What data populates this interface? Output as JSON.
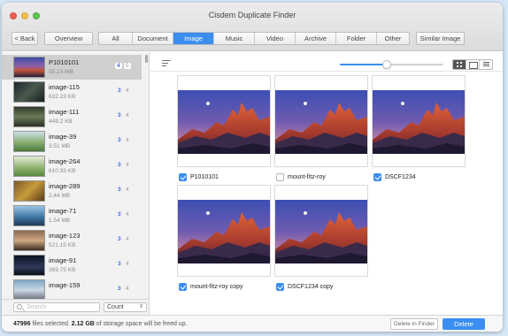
{
  "window": {
    "title": "Cisdem Duplicate Finder"
  },
  "toolbar": {
    "back_label": "< Back",
    "overview_label": "Overview",
    "categories": [
      "All",
      "Document",
      "Image",
      "Music",
      "Video",
      "Archive",
      "Folder",
      "Other"
    ],
    "active_category": "Image",
    "similar_image_label": "Similar Image"
  },
  "sidebar": {
    "items": [
      {
        "name": "P1010101",
        "size": "55.23 MB",
        "selected": "4",
        "total": "5",
        "thumb": "mountain-sunset"
      },
      {
        "name": "image-115",
        "size": "632.23 KB",
        "selected": "3",
        "total": "4",
        "thumb": "waterfall-night"
      },
      {
        "name": "image-111",
        "size": "449.2 KB",
        "selected": "3",
        "total": "4",
        "thumb": "forest-path"
      },
      {
        "name": "image-39",
        "size": "3.51 MB",
        "selected": "3",
        "total": "4",
        "thumb": "green-field"
      },
      {
        "name": "image-264",
        "size": "610.93 KB",
        "selected": "3",
        "total": "4",
        "thumb": "meadow"
      },
      {
        "name": "image-289",
        "size": "2.44 MB",
        "selected": "3",
        "total": "4",
        "thumb": "autumn-trees"
      },
      {
        "name": "image-71",
        "size": "1.54 MB",
        "selected": "3",
        "total": "4",
        "thumb": "blue-lake"
      },
      {
        "name": "image-123",
        "size": "521.15 KB",
        "selected": "3",
        "total": "4",
        "thumb": "river-bank"
      },
      {
        "name": "image-91",
        "size": "369.75 KB",
        "selected": "3",
        "total": "4",
        "thumb": "dark-sky"
      },
      {
        "name": "image-159",
        "size": "",
        "selected": "3",
        "total": "4",
        "thumb": "mountain-range"
      }
    ],
    "search_placeholder": "Search",
    "sort_value": "Count"
  },
  "viewer": {
    "zoom_level": 0.45,
    "view_modes": [
      "grid",
      "card",
      "list"
    ],
    "active_view": "grid",
    "images": [
      {
        "name": "P1010101",
        "checked": true
      },
      {
        "name": "mount-fitz-roy",
        "checked": false
      },
      {
        "name": "DSCF1234",
        "checked": true
      },
      {
        "name": "mount-fitz-roy copy",
        "checked": true
      },
      {
        "name": "DSCF1234 copy",
        "checked": true
      }
    ]
  },
  "status": {
    "files_count": "47996",
    "files_text": " files selected. ",
    "storage": "2.12 GB",
    "storage_text": " of storage space will be freed up.",
    "delete_in_finder_label": "Delete in Finder",
    "delete_label": "Delete"
  },
  "colors": {
    "accent": "#3b8ef0",
    "selected_count": "#3b6fe0"
  }
}
